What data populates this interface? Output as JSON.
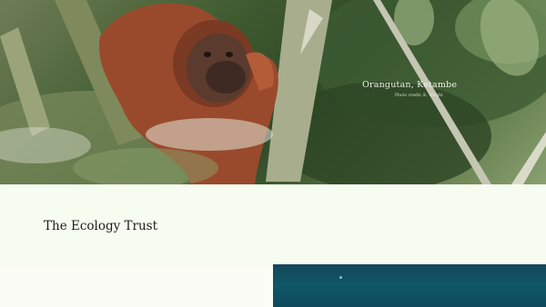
{
  "hero": {
    "image_alt": "Orangutan in rainforest trees",
    "caption_title": "Orangutan, Ketambe",
    "caption_credit": "Photo credit: K. Wright"
  },
  "intro": {
    "brand_name": "The Ecology Trust"
  },
  "colors": {
    "page_bg": "#fafcf5",
    "intro_bg": "#f7fcf1",
    "water": "#0f5767"
  }
}
